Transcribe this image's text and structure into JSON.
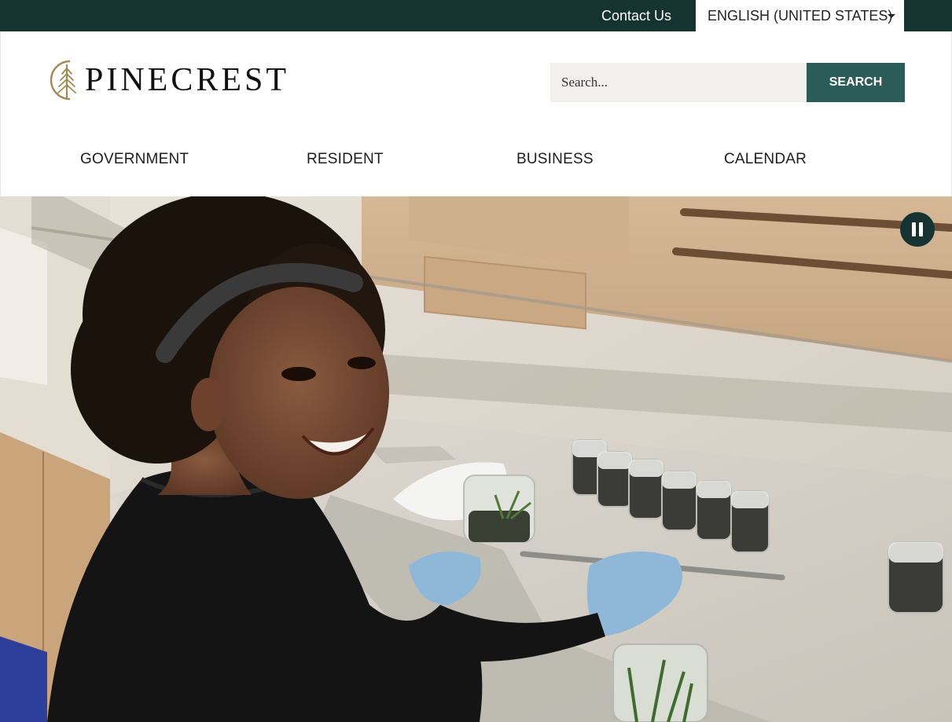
{
  "topbar": {
    "contact_label": "Contact Us",
    "language": {
      "selected": "ENGLISH (UNITED STATES)"
    }
  },
  "header": {
    "logo_text": "PINECREST",
    "search": {
      "placeholder": "Search...",
      "button_label": "SEARCH"
    }
  },
  "nav": {
    "items": [
      {
        "label": "GOVERNMENT"
      },
      {
        "label": "RESIDENT"
      },
      {
        "label": "BUSINESS"
      },
      {
        "label": "CALENDAR"
      }
    ]
  },
  "hero": {
    "icons": {
      "pause": "pause-icon"
    }
  },
  "colors": {
    "topbar_bg": "#143331",
    "search_button_bg": "#2c5c57",
    "search_input_bg": "#f2f0ed",
    "logo_gold": "#a38a55",
    "pause_button_bg": "#143331"
  }
}
